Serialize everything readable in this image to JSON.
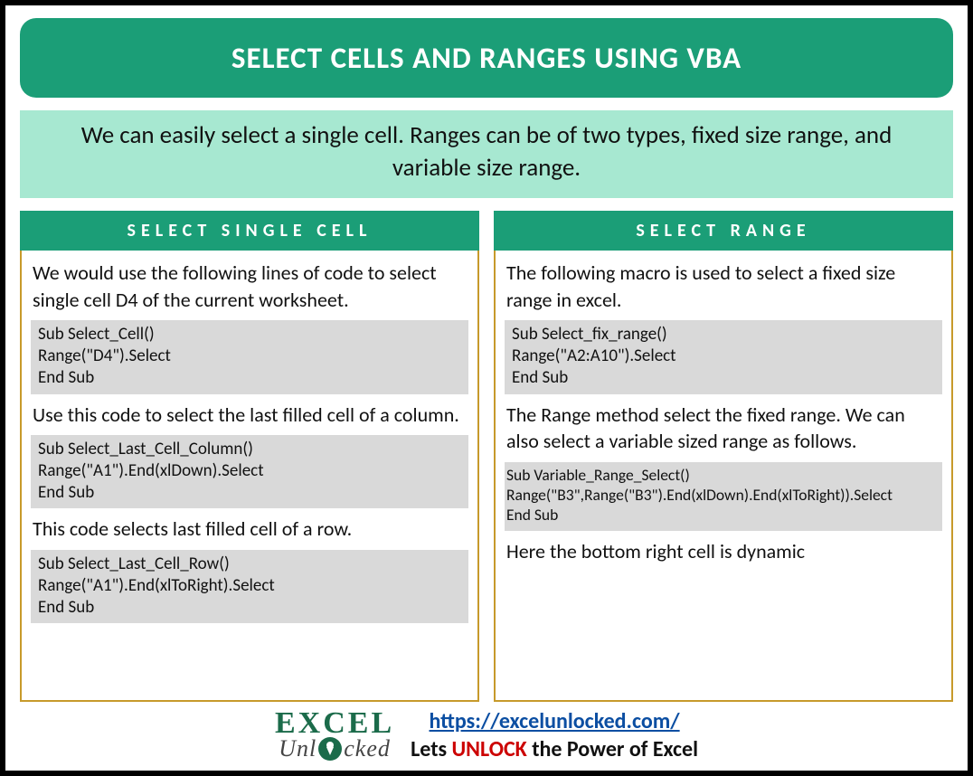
{
  "title": "SELECT CELLS AND RANGES USING VBA",
  "intro": "We can easily select a single cell. Ranges can be of two types, fixed size range, and variable size range.",
  "left": {
    "header": "SELECT SINGLE CELL",
    "p1": "We would use the following lines of code to select single cell D4 of the current worksheet.",
    "code1": "Sub Select_Cell()\nRange(\"D4\").Select\nEnd Sub",
    "p2": "Use this code to select the last filled cell of a column.",
    "code2": "Sub Select_Last_Cell_Column()\nRange(\"A1\").End(xlDown).Select\nEnd Sub",
    "p3": "This code selects last filled cell of a row.",
    "code3": "Sub Select_Last_Cell_Row()\nRange(\"A1\").End(xlToRight).Select\nEnd Sub"
  },
  "right": {
    "header": "SELECT RANGE",
    "p1": "The following macro is used to select a fixed size range in excel.",
    "code1": "Sub Select_fix_range()\nRange(\"A2:A10\").Select\nEnd Sub",
    "p2": "The Range method select the fixed range. We can also select a variable sized range as follows.",
    "code2": "Sub Variable_Range_Select()\nRange(\"B3\",Range(\"B3\").End(xlDown).End(xlToRight)).Select\nEnd Sub",
    "p3": "Here the bottom right cell is dynamic"
  },
  "footer": {
    "logo_top": "EXCEL",
    "logo_bottom_left": "Unl",
    "logo_bottom_right": "cked",
    "url": "https://excelunlocked.com/",
    "tagline_pre": "Lets ",
    "tagline_mid": "UNLOCK",
    "tagline_post": " the Power of Excel"
  }
}
